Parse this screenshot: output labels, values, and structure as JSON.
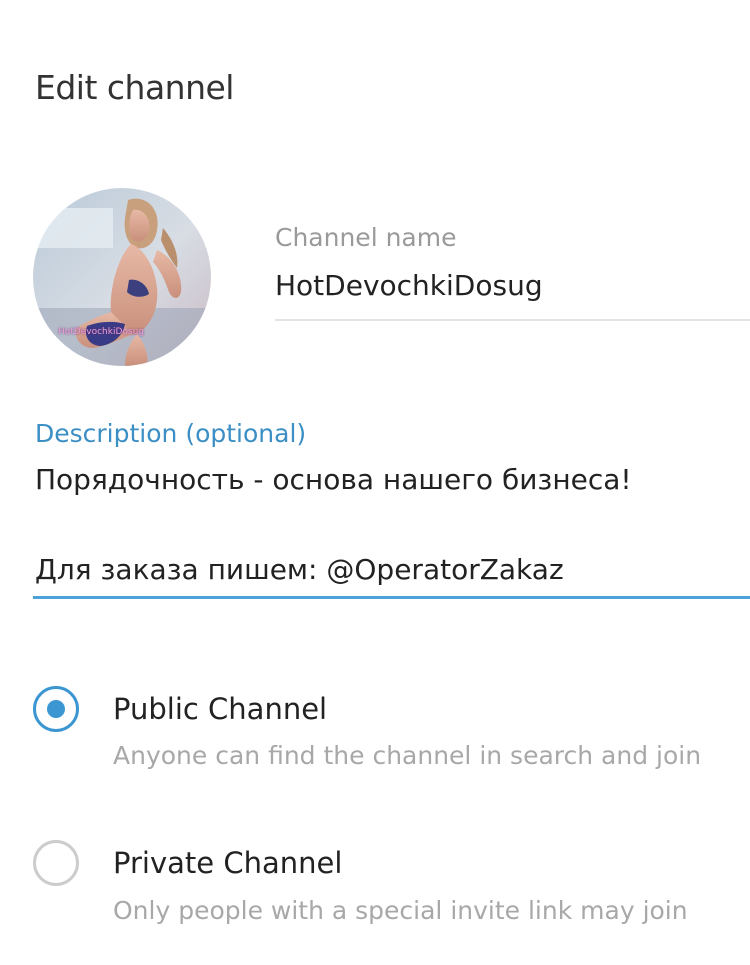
{
  "header": {
    "title": "Edit channel"
  },
  "channel": {
    "avatar_caption": "HotDevochkiDosug",
    "name_label": "Channel name",
    "name_value": "HotDevochkiDosug"
  },
  "description": {
    "label": "Description (optional)",
    "lines": [
      "Порядочность - основа нашего бизнеса!",
      "Для заказа пишем: @OperatorZakaz"
    ]
  },
  "channel_type": {
    "options": [
      {
        "title": "Public Channel",
        "description": "Anyone can find the channel in search and join",
        "selected": true
      },
      {
        "title": "Private Channel",
        "description": "Only people with a special invite link may join",
        "selected": false
      }
    ]
  },
  "colors": {
    "accent": "#3c96d2",
    "description_label": "#3c8fc4",
    "muted_text": "#a8a8a8",
    "underline_active": "#4ba1d8",
    "underline_inactive": "#e3e3e3"
  }
}
